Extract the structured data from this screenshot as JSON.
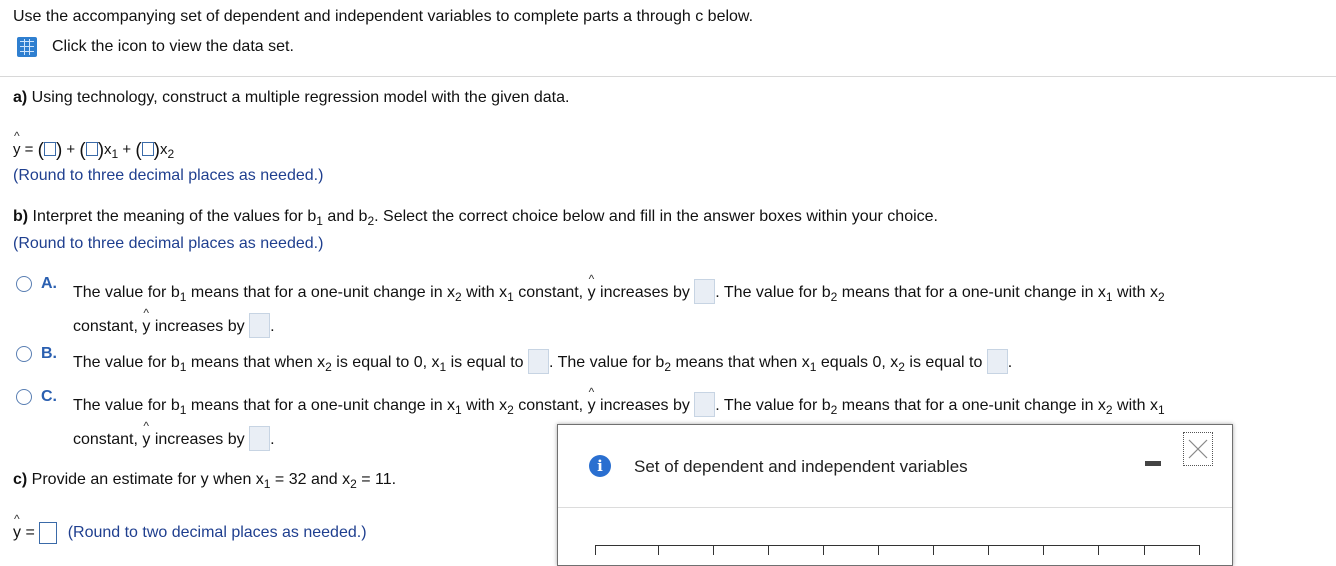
{
  "intro": "Use the accompanying set of dependent and independent variables to complete parts a through c below.",
  "data_link": "Click the icon to view the data set.",
  "part_a": {
    "label": "a)",
    "text": " Using technology, construct a multiple regression model with the given data.",
    "yhat": "y",
    "eq_eq": " = ",
    "plus": " + ",
    "x1": "x",
    "x2": "x",
    "sub1": "1",
    "sub2": "2",
    "round": "(Round to three decimal places as needed.)"
  },
  "part_b": {
    "label": "b)",
    "text_pre": " Interpret the meaning of the values for b",
    "text_mid": " and b",
    "text_post": ". Select the correct choice below and fill in the answer boxes within your choice.",
    "round": "(Round to three decimal places as needed.)",
    "choices": [
      {
        "letter": "A.",
        "line1": [
          "The value for b",
          "1",
          " means that for a one-unit change in x",
          "2",
          " with x",
          "1",
          " constant, ",
          "y",
          " increases by ",
          ". The value for b",
          "2",
          " means that for a one-unit change in x",
          "1",
          " with x",
          "2"
        ],
        "line2": [
          "constant, ",
          "y",
          " increases by ",
          "."
        ]
      },
      {
        "letter": "B.",
        "line1": [
          "The value for b",
          "1",
          " means that when x",
          "2",
          " is equal to 0, x",
          "1",
          " is equal to ",
          ". The value for b",
          "2",
          " means that when x",
          "1",
          " equals 0, x",
          "2",
          " is equal to ",
          "."
        ]
      },
      {
        "letter": "C.",
        "line1": [
          "The value for b",
          "1",
          " means that for a one-unit change in x",
          "1",
          " with x",
          "2",
          " constant, ",
          "y",
          " increases by ",
          ". The value for b",
          "2",
          " means that for a one-unit change in x",
          "2",
          " with x",
          "1"
        ],
        "line2": [
          "constant, ",
          "y",
          " increases by ",
          "."
        ]
      }
    ]
  },
  "part_c": {
    "label": "c)",
    "text_pre": " Provide an estimate for y when x",
    "sub1": "1",
    "text_mid": " = 32 and x",
    "sub2": "2",
    "text_post": " = 11.",
    "yhat": "y",
    "eq": " = ",
    "round": "(Round to two decimal places as needed.)"
  },
  "popup": {
    "title": "Set of dependent and independent variables",
    "info_icon": "i"
  },
  "colors": {
    "accent": "#2a6fd0",
    "hint_text": "#1f3f8f",
    "input_fill": "#e9eef5"
  },
  "icons": [
    "grid-table-icon",
    "info-icon",
    "minimize-icon",
    "close-icon"
  ]
}
